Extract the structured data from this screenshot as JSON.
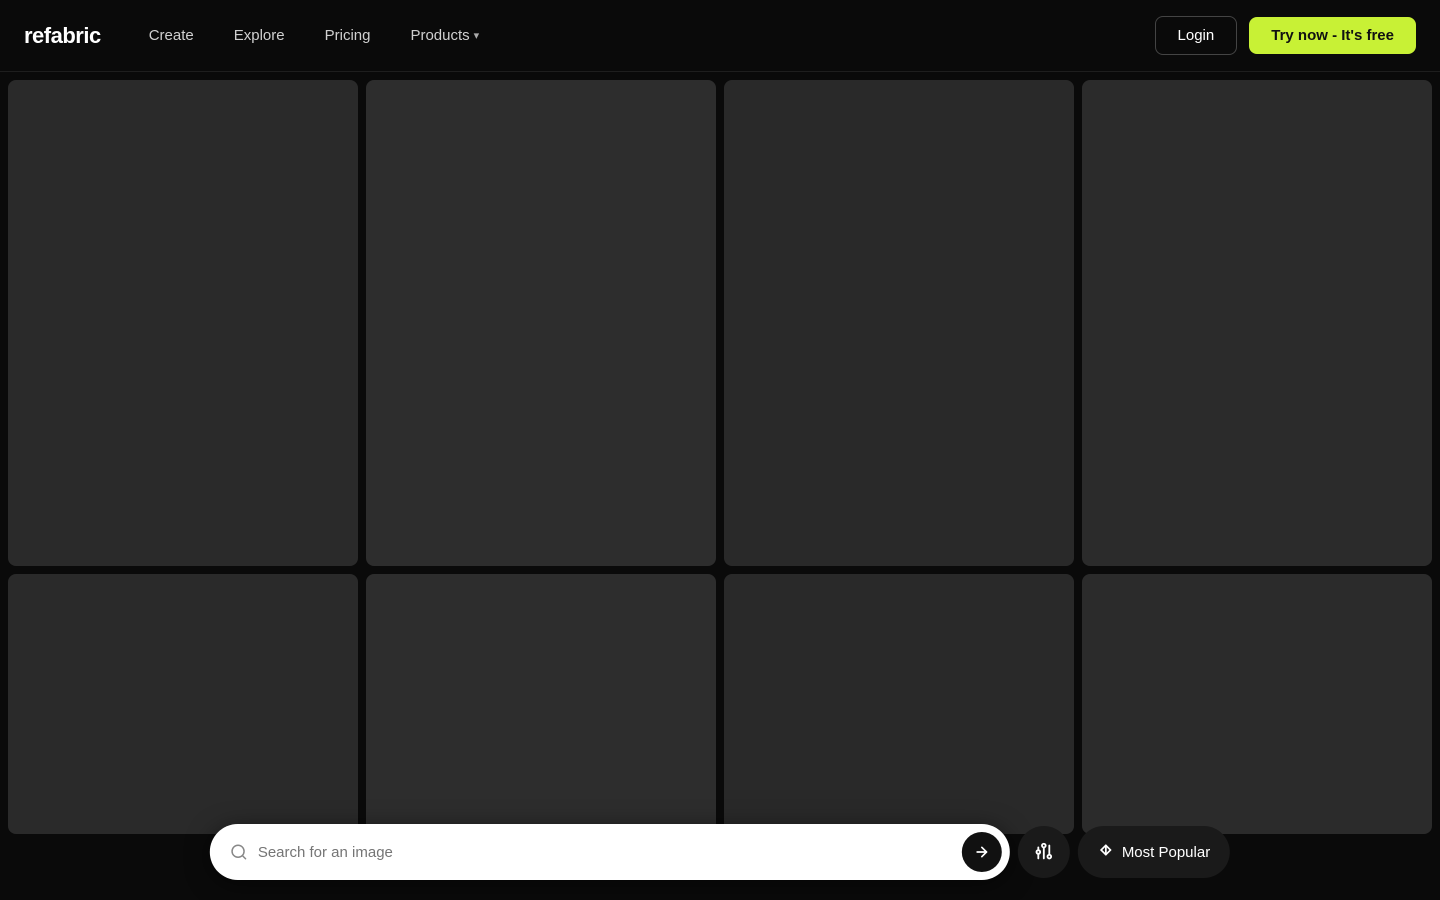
{
  "brand": {
    "logo": "refabric"
  },
  "nav": {
    "links": [
      {
        "id": "create",
        "label": "Create",
        "hasDropdown": false
      },
      {
        "id": "explore",
        "label": "Explore",
        "hasDropdown": false
      },
      {
        "id": "pricing",
        "label": "Pricing",
        "hasDropdown": false
      },
      {
        "id": "products",
        "label": "Products",
        "hasDropdown": true
      }
    ],
    "login_label": "Login",
    "try_label": "Try now - It's free"
  },
  "grid": {
    "rows": [
      {
        "row_index": 0,
        "size": "tall",
        "cells": [
          {
            "id": "r0c0",
            "bg": "#2a2a2a"
          },
          {
            "id": "r0c1",
            "bg": "#2d2d2d"
          },
          {
            "id": "r0c2",
            "bg": "#292929"
          },
          {
            "id": "r0c3",
            "bg": "#2b2b2b"
          }
        ]
      },
      {
        "row_index": 1,
        "size": "short",
        "cells": [
          {
            "id": "r1c0",
            "bg": "#2a2a2a"
          },
          {
            "id": "r1c1",
            "bg": "#2d2d2d"
          },
          {
            "id": "r1c2",
            "bg": "#292929"
          },
          {
            "id": "r1c3",
            "bg": "#2b2b2b"
          }
        ]
      }
    ]
  },
  "search_bar": {
    "placeholder": "Search for an image",
    "filter_icon": "🪣",
    "sort_label": "Most Popular",
    "sort_icon": "↕"
  }
}
